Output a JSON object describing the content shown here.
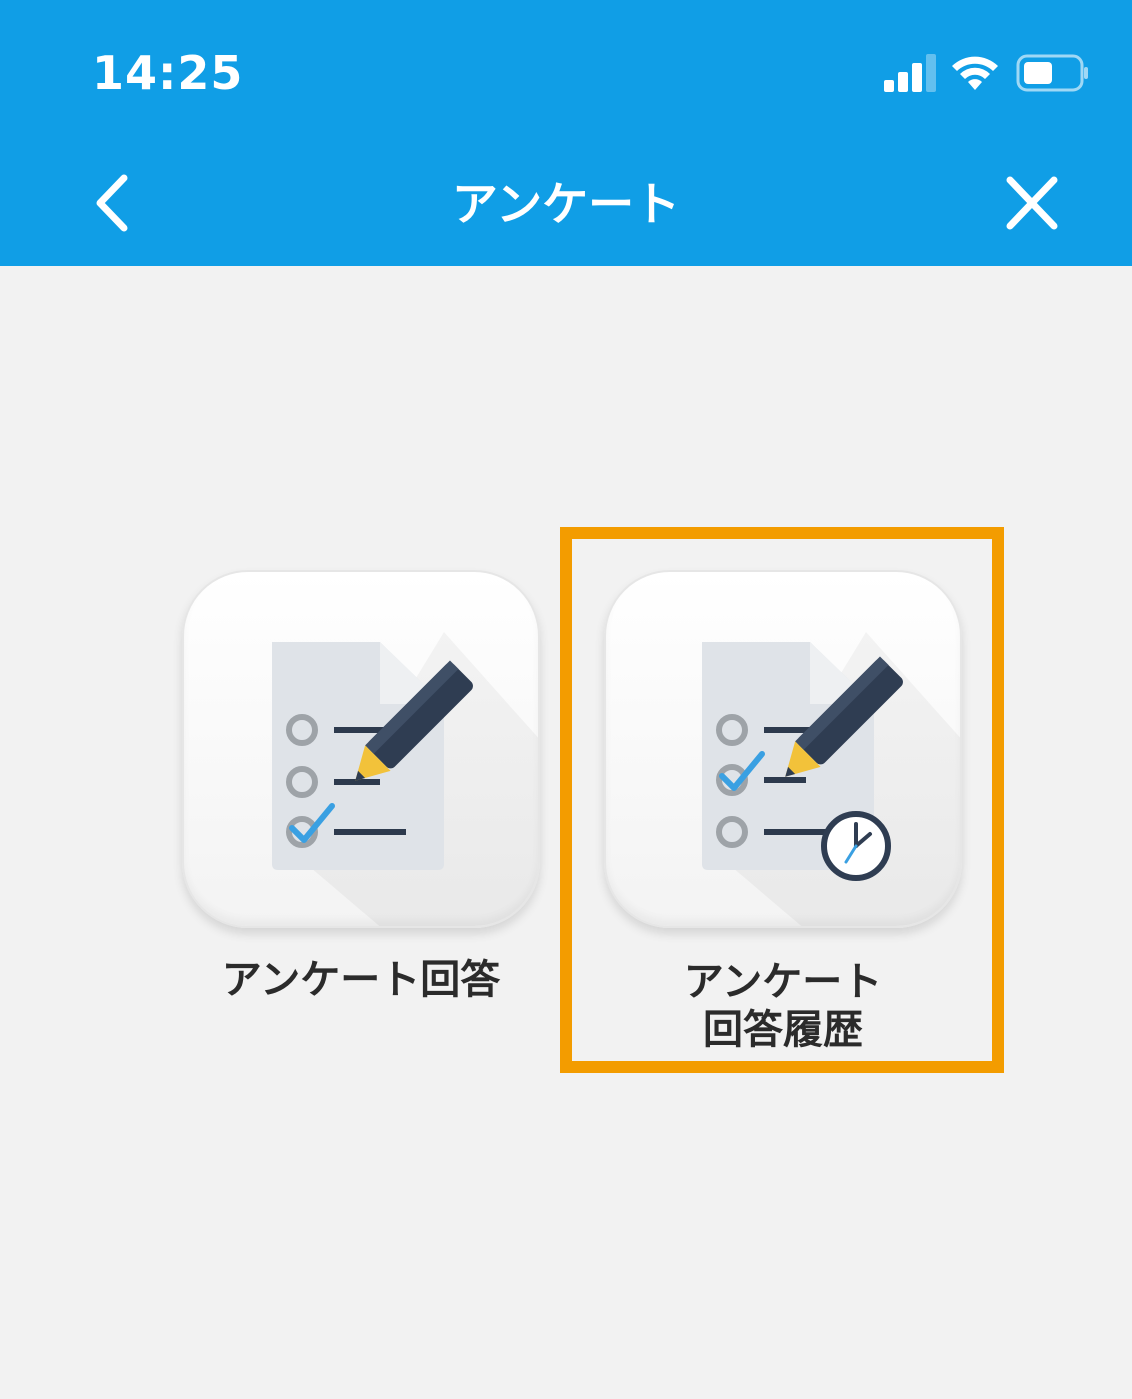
{
  "status_bar": {
    "time": "14:25"
  },
  "nav": {
    "title": "アンケート",
    "back_icon": "chevron-left-icon",
    "close_icon": "close-icon"
  },
  "tiles": [
    {
      "label": "アンケート回答",
      "icon": "survey-answer-icon"
    },
    {
      "label_line1": "アンケート",
      "label_line2": "回答履歴",
      "icon": "survey-history-icon",
      "highlighted": true
    }
  ],
  "colors": {
    "header": "#109ee6",
    "highlight": "#f39c00",
    "background": "#f2f2f2"
  }
}
